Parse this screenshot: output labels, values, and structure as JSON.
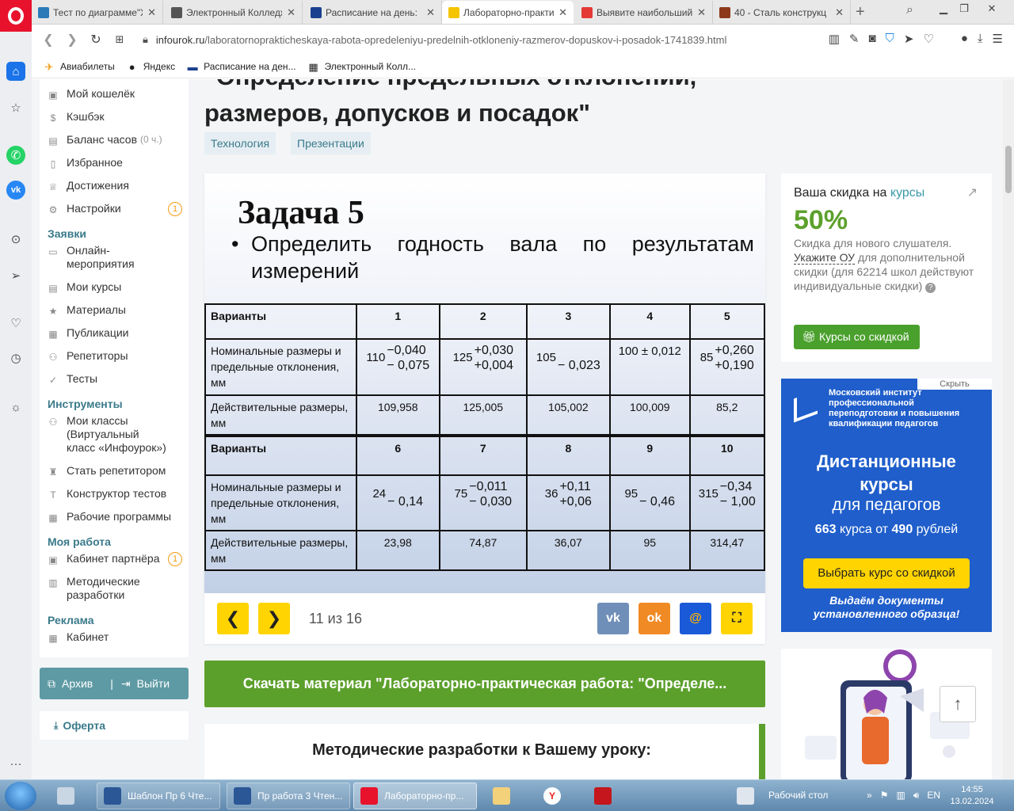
{
  "browser": {
    "tabs": [
      {
        "label": "Тест по диаграмме\"Ж",
        "color": "#2b7bb9"
      },
      {
        "label": "Электронный Колледж",
        "color": "#555555"
      },
      {
        "label": "Расписание на день: ",
        "color": "#1b3f8f"
      },
      {
        "label": "Лабораторно-практи",
        "color": "#f5c400"
      },
      {
        "label": "Выявите наибольший",
        "color": "#e53935"
      },
      {
        "label": "40 - Сталь конструкц",
        "color": "#8d3a1a"
      }
    ],
    "new_tab": "+",
    "url_domain": "infourok.ru",
    "url_path": "/laboratornoprakticheskaya-rabota-opredeleniyu-predelnih-otkloneniy-razmerov-dopuskov-i-posadok-1741839.html",
    "bookmarks": [
      {
        "label": "Авиабилеты",
        "icon": "plane-icon"
      },
      {
        "label": "Яндекс",
        "icon": "yandex-icon"
      },
      {
        "label": "Расписание на ден...",
        "icon": "calendar-icon"
      },
      {
        "label": "Электронный Колл...",
        "icon": "college-icon"
      }
    ]
  },
  "nav": {
    "items1": [
      {
        "label": "Мой кошелёк",
        "icon": "wallet-icon"
      },
      {
        "label": "Кэшбэк",
        "icon": "cashback-icon"
      },
      {
        "label": "Баланс часов",
        "extra": "(0 ч.)",
        "icon": "clock-icon"
      },
      {
        "label": "Избранное",
        "icon": "bookmark-icon"
      },
      {
        "label": "Достижения",
        "icon": "trophy-icon"
      },
      {
        "label": "Настройки",
        "icon": "gear-icon",
        "badge": "1"
      }
    ],
    "section_applications": "Заявки",
    "items2": [
      {
        "label": "Онлайн-\nмероприятия",
        "icon": "video-icon"
      },
      {
        "label": "Мои курсы",
        "icon": "courses-icon"
      },
      {
        "label": "Материалы",
        "icon": "star-icon"
      },
      {
        "label": "Публикации",
        "icon": "publications-icon"
      },
      {
        "label": "Репетиторы",
        "icon": "tutors-icon"
      },
      {
        "label": "Тесты",
        "icon": "check-icon"
      }
    ],
    "section_tools": "Инструменты",
    "items3": [
      {
        "label": "Мои классы\n(Виртуальный\nкласс «Инфоурок»)",
        "icon": "classes-icon"
      },
      {
        "label": "Стать репетитором",
        "icon": "tutor-icon"
      },
      {
        "label": "Конструктор тестов",
        "icon": "text-icon"
      },
      {
        "label": "Рабочие программы",
        "icon": "calendar-icon"
      }
    ],
    "section_work": "Моя работа",
    "items4": [
      {
        "label": "Кабинет партнёра",
        "icon": "partner-icon",
        "badge": "1"
      },
      {
        "label": "Методические\nразработки",
        "icon": "book-icon"
      }
    ],
    "section_ads": "Реклама",
    "items5": [
      {
        "label": "Кабинет",
        "icon": "grid-icon"
      }
    ],
    "archive": "Архив",
    "logout": "Выйти",
    "oferta": "Оферта"
  },
  "main": {
    "title": "\"Определение предельных отклонений,\nразмеров, допусков и посадок\"",
    "tags": [
      "Технология",
      "Презентации"
    ],
    "slide": {
      "heading": "Задача 5",
      "bullet": "Определить годность вала по результатам",
      "bullet2": "измерений",
      "table": {
        "header_label": "Варианты",
        "row_nominal": "Номинальные размеры и предельные отклонения, мм",
        "row_actual": "Действительные размеры, мм",
        "block1": {
          "variants": [
            "1",
            "2",
            "3",
            "4",
            "5"
          ],
          "nominal": [
            {
              "base": "110",
              "upper": "−0,040",
              "lower": "− 0,075"
            },
            {
              "base": "125",
              "upper": "+0,030",
              "lower": "+0,004"
            },
            {
              "base": "105",
              "upper": "",
              "lower": "− 0,023"
            },
            {
              "base": "100 ± 0,012",
              "upper": "",
              "lower": ""
            },
            {
              "base": "85",
              "upper": "+0,260",
              "lower": "+0,190"
            }
          ],
          "actual": [
            "109,958",
            "125,005",
            "105,002",
            "100,009",
            "85,2"
          ]
        },
        "block2": {
          "variants": [
            "6",
            "7",
            "8",
            "9",
            "10"
          ],
          "nominal": [
            {
              "base": "24",
              "upper": "",
              "lower": "− 0,14"
            },
            {
              "base": "75",
              "upper": "−0,011",
              "lower": "− 0,030"
            },
            {
              "base": "36",
              "upper": "+0,11",
              "lower": "+0,06"
            },
            {
              "base": "95",
              "upper": "",
              "lower": "− 0,46"
            },
            {
              "base": "315",
              "upper": "−0,34",
              "lower": "− 1,00"
            }
          ],
          "actual": [
            "23,98",
            "74,87",
            "36,07",
            "95",
            "314,47"
          ]
        }
      }
    },
    "slide_counter": "11 из 16",
    "prev": "❮",
    "next": "❯",
    "share": {
      "vk": "vk",
      "ok": "ok",
      "mail": "@"
    },
    "download": "Скачать материал \"Лабораторно-практическая работа: \"Определе...",
    "methods_title": "Методические разработки к Вашему уроку:"
  },
  "discount": {
    "heading": "Ваша скидка на ",
    "heading_link": "курсы",
    "percent": "50%",
    "desc": "Скидка для нового слушателя.",
    "link": "Укажите ОУ",
    "desc2": " для дополнительной скидки (для 62214 школ действуют индивидуальные скидки)",
    "button": "Курсы со скидкой"
  },
  "ad": {
    "hide": "Скрыть",
    "org": "Московский институт профессиональной переподготовки и повышения квалификации педагогов",
    "title": "Дистанционные курсы",
    "subtitle": "для педагогов",
    "price_pre": "663",
    "price_mid": " курса от ",
    "price_val": "490",
    "price_post": " рублей",
    "button": "Выбрать курс со скидкой",
    "footer": "Выдаём документы установленного образца!"
  },
  "taskbar": {
    "apps": [
      {
        "label": "Шаблон Пр 6 Чте...",
        "color": "#2b5797"
      },
      {
        "label": "Пр работа 3 Чтен...",
        "color": "#2b5797"
      },
      {
        "label": "Лабораторно-пр...",
        "color": "#e8122d"
      }
    ],
    "desktop": "Рабочий стол",
    "time": "14:55",
    "date": "13.02.2024"
  }
}
